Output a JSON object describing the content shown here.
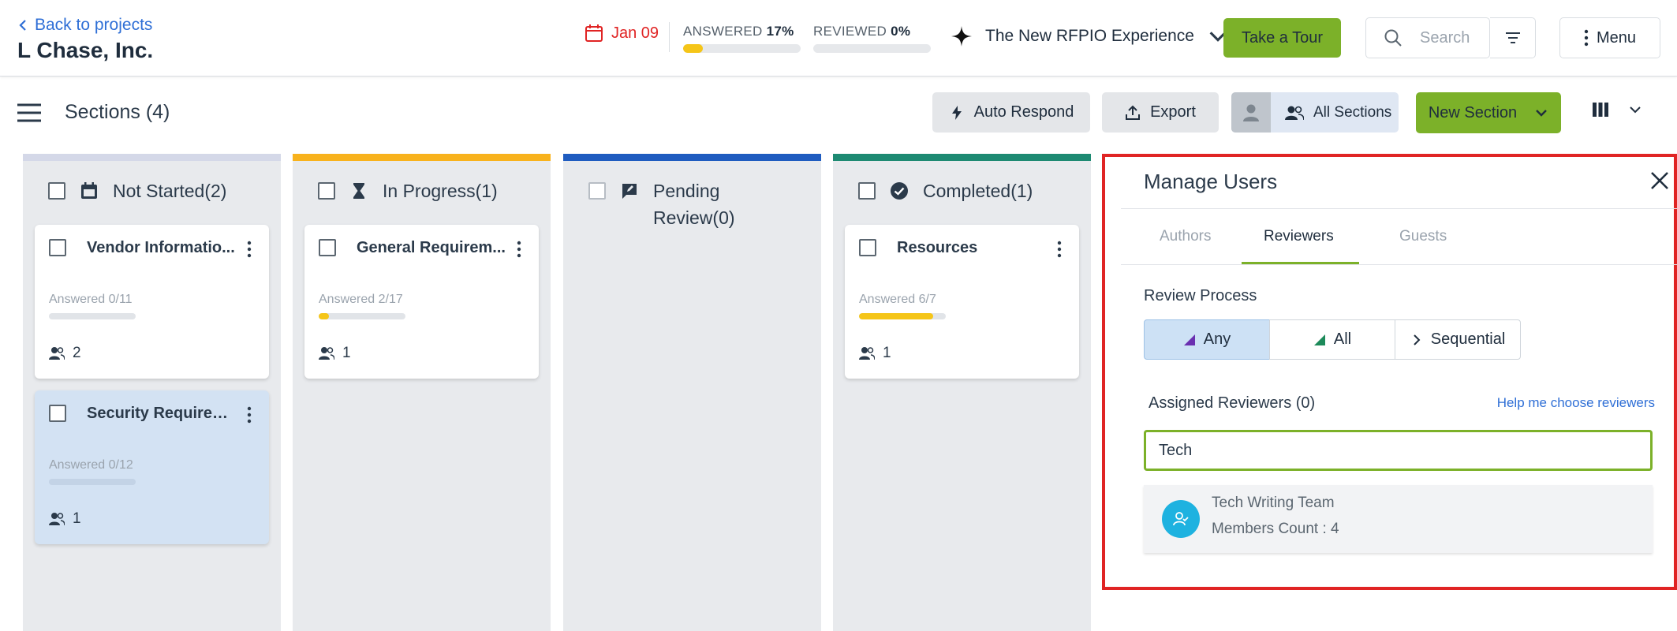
{
  "header": {
    "back_label": "Back to projects",
    "project_name": "L Chase, Inc.",
    "due_date": "Jan 09",
    "answered": {
      "label": "ANSWERED",
      "percent_text": "17%",
      "percent": 17
    },
    "reviewed": {
      "label": "REVIEWED",
      "percent_text": "0%",
      "percent": 0
    },
    "experience_label": "The New RFPIO Experience",
    "tour_label": "Take a Tour",
    "search_placeholder": "Search",
    "menu_label": "Menu"
  },
  "toolbar": {
    "sections_title": "Sections (4)",
    "auto_respond_label": "Auto Respond",
    "export_label": "Export",
    "assign_label": "All Sections",
    "new_section_label": "New Section"
  },
  "columns": [
    {
      "title": "Not Started(2)",
      "color": "#d4d8e8",
      "icon": "calendar-icon",
      "cards": [
        {
          "title": "Vendor Informatio...",
          "answered": "Answered 0/11",
          "progress": 0,
          "users": "2",
          "selected": false
        },
        {
          "title": "Security Requirem...",
          "answered": "Answered 0/12",
          "progress": 0,
          "users": "1",
          "selected": true
        }
      ]
    },
    {
      "title": "In Progress(1)",
      "color": "#f8b21c",
      "icon": "hourglass-icon",
      "cards": [
        {
          "title": "General Requirem...",
          "answered": "Answered 2/17",
          "progress": 11.8,
          "users": "1",
          "selected": false
        }
      ]
    },
    {
      "title_line1": "Pending",
      "title_line2": "Review(0)",
      "color": "#1f5cc0",
      "icon": "review-icon",
      "cards": []
    },
    {
      "title": "Completed(1)",
      "color": "#1d8a72",
      "icon": "check-circle-icon",
      "cards": [
        {
          "title": "Resources",
          "answered": "Answered 6/7",
          "progress": 85.7,
          "users": "1",
          "selected": false
        }
      ]
    }
  ],
  "manage_users": {
    "title": "Manage Users",
    "tabs": [
      "Authors",
      "Reviewers",
      "Guests"
    ],
    "active_tab": "Reviewers",
    "review_process_label": "Review Process",
    "process_options": [
      "Any",
      "All",
      "Sequential"
    ],
    "selected_process": "Any",
    "assigned_label": "Assigned Reviewers (0)",
    "help_link": "Help me choose reviewers",
    "search_value": "Tech",
    "results": [
      {
        "name": "Tech Writing Team",
        "count": "Members Count : 4"
      }
    ]
  },
  "colors": {
    "accent_green": "#7cb129",
    "link_blue": "#2f6fd6",
    "due_red": "#e02424",
    "highlight_red": "#e02424",
    "progress_yellow": "#f5c518"
  }
}
